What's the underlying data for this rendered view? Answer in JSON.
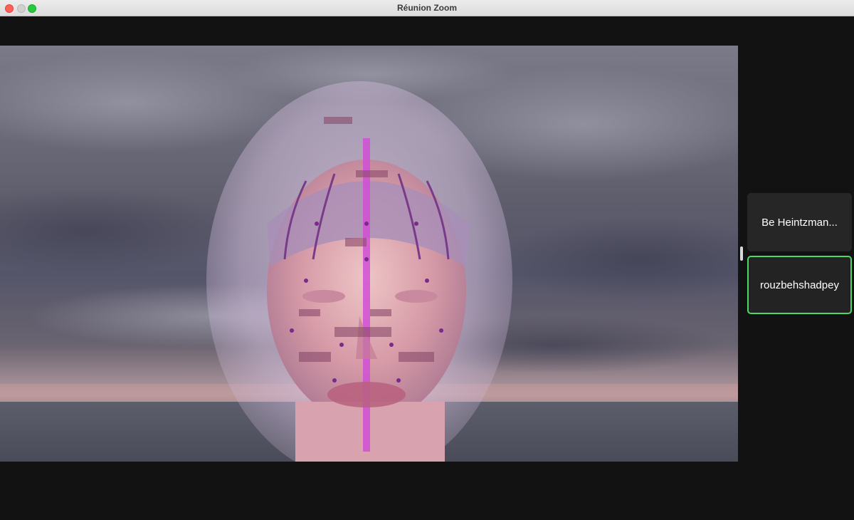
{
  "window": {
    "title": "Réunion Zoom"
  },
  "traffic_lights": {
    "close_color": "#fe5f57",
    "minimize_color": "#d0d0d0",
    "maximize_color": "#28c840"
  },
  "main_video": {
    "description_icon": "video-feed"
  },
  "participants": [
    {
      "name": "Be Heintzman...",
      "active_speaker": false
    },
    {
      "name": "rouzbehshadpey",
      "active_speaker": true
    }
  ],
  "colors": {
    "active_speaker_border": "#4cd964",
    "tile_background": "#262626",
    "window_background": "#121212"
  }
}
